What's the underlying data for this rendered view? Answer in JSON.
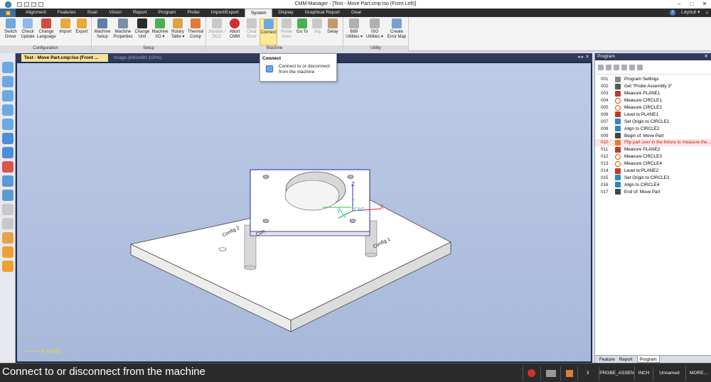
{
  "window": {
    "title": "CMM-Manager - [Test - Move Part.cmp:Iso (Front Left)]",
    "layout_label": "Layout",
    "help_label": "?"
  },
  "tabs": [
    "Alignment",
    "Features",
    "Scan",
    "Vision",
    "Report",
    "Program",
    "Probe",
    "Import/Export",
    "System",
    "Display",
    "Graphical Report",
    "Gear"
  ],
  "active_tab": "System",
  "ribbon": {
    "groups": [
      {
        "label": "Configuration",
        "buttons": [
          {
            "label": "Switch Driver"
          },
          {
            "label": "Check Update"
          },
          {
            "label": "Change Language"
          },
          {
            "label": "Import"
          },
          {
            "label": "Export"
          }
        ]
      },
      {
        "label": "Setup",
        "buttons": [
          {
            "label": "Machine Setup"
          },
          {
            "label": "Machine Properties"
          },
          {
            "label": "Change Unit"
          },
          {
            "label": "Machine I/O"
          },
          {
            "label": "Rotary Table"
          },
          {
            "label": "Thermal Comp"
          }
        ]
      },
      {
        "label": "Machine",
        "buttons": [
          {
            "label": "Joystick / DCC"
          },
          {
            "label": "Abort CMM"
          },
          {
            "label": "Clear Error"
          },
          {
            "label": "Connect"
          },
          {
            "label": "Home Axes"
          },
          {
            "label": "Go To"
          },
          {
            "label": "Jog"
          },
          {
            "label": "Delay"
          }
        ]
      },
      {
        "label": "Utility",
        "buttons": [
          {
            "label": "B89 Utilities"
          },
          {
            "label": "ISO Utilities"
          },
          {
            "label": "Create Error Map"
          }
        ]
      }
    ]
  },
  "tooltip": {
    "title": "Connect",
    "body": "Connect to or disconnect from the machine"
  },
  "document_tabs": [
    {
      "label": "Test - Move Part.cmp:Iso (Front ...",
      "active": true
    },
    {
      "label": "Image (640x480 100%)",
      "active": false
    }
  ],
  "viewport": {
    "scale_label": "0.4 inch",
    "part_labels": [
      "Config 2",
      "Con",
      "Config 1"
    ],
    "axis_labels": {
      "z": "Z",
      "x": "X",
      "y": "Y",
      "z2": "Z",
      "cad": "CAD"
    }
  },
  "program_panel": {
    "title": "Program",
    "items": [
      {
        "num": "001",
        "text": "Program Settings",
        "icon": "settings-icon",
        "color": "#888888"
      },
      {
        "num": "002",
        "text": "Get \"Probe Assembly 3\"",
        "icon": "probe-icon",
        "color": "#555555"
      },
      {
        "num": "003",
        "text": "Measure PLANE1",
        "icon": "plane-icon",
        "color": "#c0392b"
      },
      {
        "num": "004",
        "text": "Measure CIRCLE1",
        "icon": "circle-icon",
        "color": "#d35400"
      },
      {
        "num": "005",
        "text": "Measure CIRCLE2",
        "icon": "circle-icon",
        "color": "#d35400"
      },
      {
        "num": "006",
        "text": "Level to PLANE1",
        "icon": "level-icon",
        "color": "#c0392b"
      },
      {
        "num": "007",
        "text": "Set Origin to CIRCLE1",
        "icon": "origin-icon",
        "color": "#2e86c1"
      },
      {
        "num": "008",
        "text": "Align to CIRCLE2",
        "icon": "align-icon",
        "color": "#2e86c1"
      },
      {
        "num": "009",
        "text": "Begin of: Move Part",
        "icon": "begin-icon",
        "color": "#444444"
      },
      {
        "num": "010",
        "text": "Flip part over in the fixture to measure the...",
        "icon": "warning-icon",
        "color": "#e67e22",
        "highlight": true
      },
      {
        "num": "011",
        "text": "Measure PLANE2",
        "icon": "plane-icon",
        "color": "#c0392b"
      },
      {
        "num": "012",
        "text": "Measure CIRCLE3",
        "icon": "circle-icon",
        "color": "#d35400"
      },
      {
        "num": "013",
        "text": "Measure CIRCLE4",
        "icon": "circle-icon",
        "color": "#d35400"
      },
      {
        "num": "014",
        "text": "Level to PLANE2",
        "icon": "level-icon",
        "color": "#c0392b"
      },
      {
        "num": "015",
        "text": "Set Origin to CIRCLE3",
        "icon": "origin-icon",
        "color": "#2e86c1"
      },
      {
        "num": "016",
        "text": "Align to CIRCLE4",
        "icon": "align-icon",
        "color": "#2e86c1"
      },
      {
        "num": "017",
        "text": "End of: Move Part",
        "icon": "end-icon",
        "color": "#444444"
      }
    ],
    "bottom_tabs": [
      "Feature",
      "Report",
      "Program"
    ],
    "active_bottom_tab": "Program"
  },
  "status_bar": {
    "message": "Connect to or disconnect from the machine",
    "count": "3",
    "probe": "PROBE_ASSEN",
    "unit": "INCH",
    "frame": "Unnamed",
    "more": "MORE..."
  }
}
